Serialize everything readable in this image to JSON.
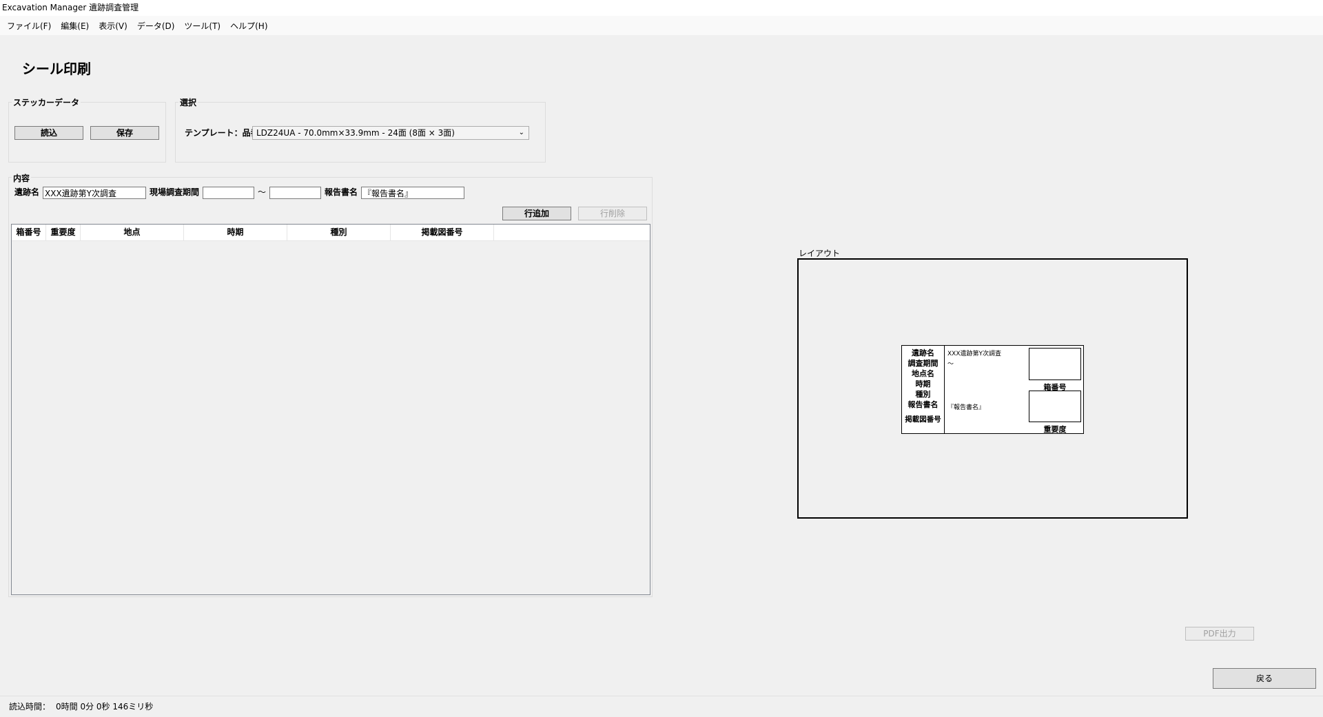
{
  "window": {
    "title": "Excavation Manager 遺跡調査管理"
  },
  "menu": [
    "ファイル(F)",
    "編集(E)",
    "表示(V)",
    "データ(D)",
    "ツール(T)",
    "ヘルプ(H)"
  ],
  "page": {
    "title": "シール印刷"
  },
  "sticker_data": {
    "label": "ステッカーデータ",
    "load_button": "読込",
    "save_button": "保存"
  },
  "selection": {
    "label": "選択",
    "template_label": "テンプレート：品番",
    "template_value": "LDZ24UA  - 70.0mm×33.9mm   - 24面 (8面 × 3面)"
  },
  "content": {
    "label": "内容",
    "site_name_label": "遺跡名",
    "site_name_value": "XXX遺跡第Y次調査",
    "period_label": "現場調査期間",
    "period_start": "",
    "period_sep": "～",
    "period_end": "",
    "report_label": "報告書名",
    "report_value": "『報告書名』",
    "add_row_button": "行追加",
    "delete_row_button": "行削除",
    "columns": [
      "箱番号",
      "重要度",
      "地点",
      "時期",
      "種別",
      "掲載図番号"
    ]
  },
  "layout": {
    "label": "レイアウト",
    "sticker": {
      "labels": [
        "遺跡名",
        "調査期間",
        "地点名",
        "時期",
        "種別",
        "報告書名",
        "掲載図番号"
      ],
      "site_name": "XXX遺跡第Y次調査",
      "period": "～",
      "report": "『報告書名』",
      "box_number_label": "箱番号",
      "importance_label": "重要度"
    }
  },
  "pdf_button": "PDF出力",
  "back_button": "戻る",
  "status": {
    "label": "読込時間：",
    "value": "0時間 0分 0秒 146ミリ秒"
  }
}
